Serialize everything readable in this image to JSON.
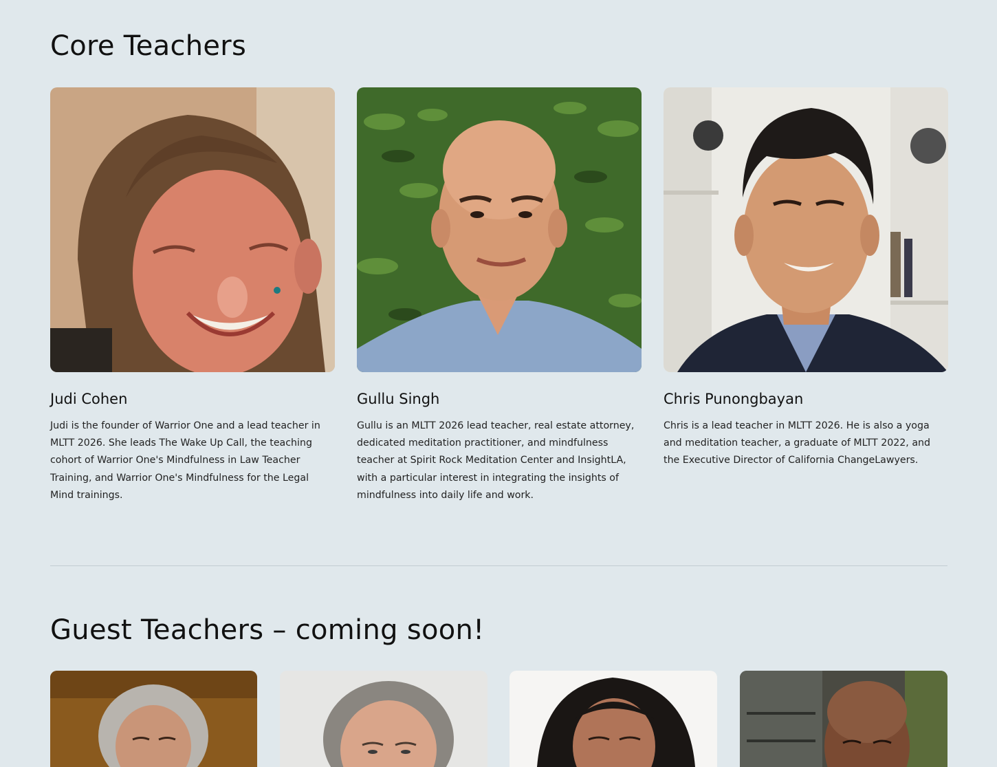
{
  "core_section": {
    "title": "Core Teachers",
    "teachers": [
      {
        "name": "Judi Cohen",
        "bio": "Judi is the founder of Warrior One and a lead teacher in MLTT 2026. She leads The Wake Up Call, the teaching cohort of Warrior One's Mindfulness in Law Teacher Training, and Warrior One's Mindfulness for the Legal Mind trainings."
      },
      {
        "name": "Gullu Singh",
        "bio": "Gullu is an MLTT 2026 lead teacher, real estate attorney, dedicated meditation practitioner, and mindfulness teacher at Spirit Rock Meditation Center and InsightLA, with a particular interest in integrating the insights of mindfulness into daily life and work."
      },
      {
        "name": "Chris Punongbayan",
        "bio": "Chris is a lead teacher in MLTT 2026. He is also a yoga and meditation teacher, a graduate of MLTT 2022, and the Executive Director of California ChangeLawyers."
      }
    ]
  },
  "guest_section": {
    "title": "Guest Teachers – coming soon!"
  },
  "colors": {
    "page_background": "#e0e8ec",
    "text": "#111111",
    "divider": "#c2ccd1"
  }
}
